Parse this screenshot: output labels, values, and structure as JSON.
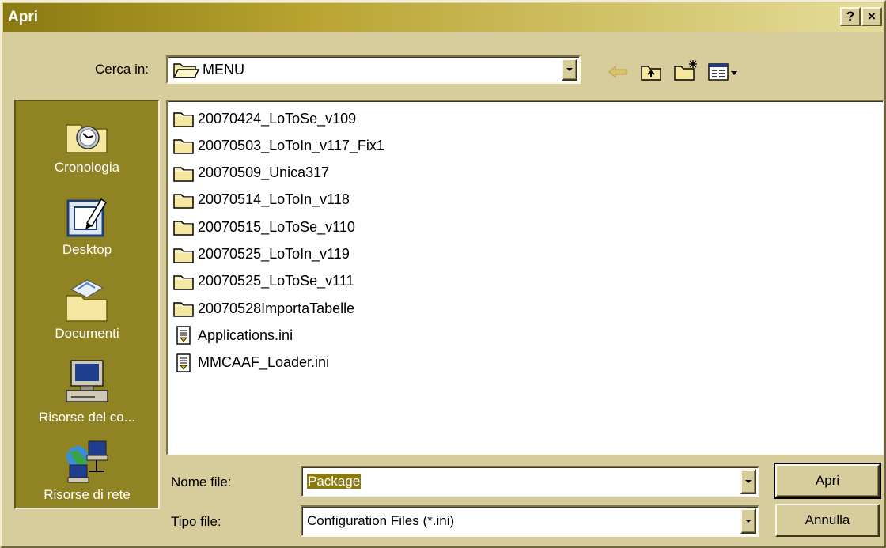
{
  "window": {
    "title": "Apri",
    "help_label": "?",
    "close_label": "×"
  },
  "lookin": {
    "label": "Cerca in:",
    "value": "MENU"
  },
  "toolbar": {
    "back": "back-arrow-icon",
    "up": "up-folder-icon",
    "new_folder": "new-folder-icon",
    "view_menu": "view-menu-icon"
  },
  "places": [
    {
      "label": "Cronologia",
      "icon": "history-icon"
    },
    {
      "label": "Desktop",
      "icon": "desktop-icon"
    },
    {
      "label": "Documenti",
      "icon": "documents-icon"
    },
    {
      "label": "Risorse del co...",
      "icon": "computer-icon"
    },
    {
      "label": "Risorse di rete",
      "icon": "network-icon"
    }
  ],
  "files": [
    {
      "name": "20070424_LoToSe_v109",
      "type": "folder"
    },
    {
      "name": "20070503_LoToIn_v117_Fix1",
      "type": "folder"
    },
    {
      "name": "20070509_Unica317",
      "type": "folder"
    },
    {
      "name": "20070514_LoToIn_v118",
      "type": "folder"
    },
    {
      "name": "20070515_LoToSe_v110",
      "type": "folder"
    },
    {
      "name": "20070525_LoToIn_v119",
      "type": "folder"
    },
    {
      "name": "20070525_LoToSe_v111",
      "type": "folder"
    },
    {
      "name": "20070528ImportaTabelle",
      "type": "folder"
    },
    {
      "name": "Applications.ini",
      "type": "file"
    },
    {
      "name": "MMCAAF_Loader.ini",
      "type": "file"
    }
  ],
  "filename": {
    "label": "Nome file:",
    "value": "Package"
  },
  "filetype": {
    "label": "Tipo file:",
    "value": "Configuration Files (*.ini)"
  },
  "buttons": {
    "open": "Apri",
    "cancel": "Annulla"
  },
  "colors": {
    "accent": "#8a7a10",
    "places_bg": "#8f8324",
    "face": "#d6cc9c"
  }
}
